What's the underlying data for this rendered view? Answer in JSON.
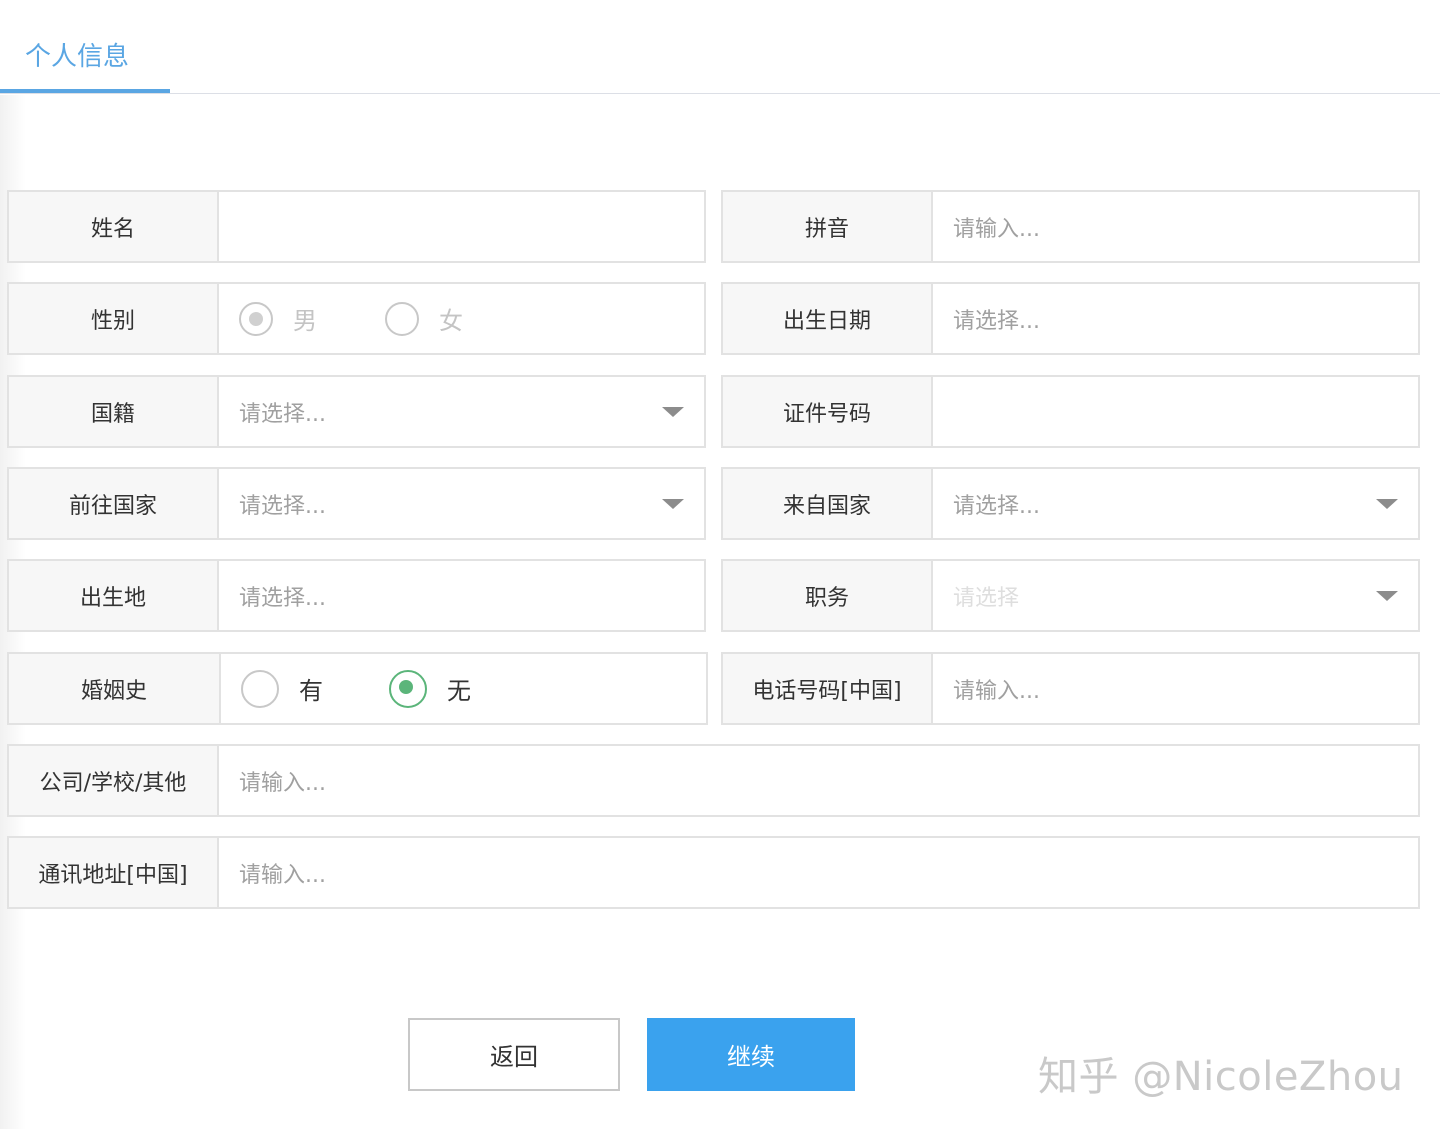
{
  "tabs": [
    {
      "label": "个人信息",
      "active": true
    }
  ],
  "form": {
    "name": {
      "label": "姓名",
      "value": ""
    },
    "pinyin": {
      "label": "拼音",
      "placeholder": "请输入..."
    },
    "gender": {
      "label": "性别",
      "options": [
        "男",
        "女"
      ],
      "selected": "男",
      "disabled": true
    },
    "birth_date": {
      "label": "出生日期",
      "placeholder": "请选择..."
    },
    "nationality": {
      "label": "国籍",
      "placeholder": "请选择..."
    },
    "id_number": {
      "label": "证件号码",
      "value": ""
    },
    "destination_country": {
      "label": "前往国家",
      "placeholder": "请选择..."
    },
    "from_country": {
      "label": "来自国家",
      "placeholder": "请选择..."
    },
    "birthplace": {
      "label": "出生地",
      "placeholder": "请选择..."
    },
    "position": {
      "label": "职务",
      "placeholder": "请选择",
      "disabled": true
    },
    "marital_history": {
      "label": "婚姻史",
      "options": [
        "有",
        "无"
      ],
      "selected": "无"
    },
    "phone": {
      "label": "电话号码[中国]",
      "placeholder": "请输入..."
    },
    "organization": {
      "label": "公司/学校/其他",
      "placeholder": "请输入..."
    },
    "address": {
      "label": "通讯地址[中国]",
      "placeholder": "请输入..."
    }
  },
  "buttons": {
    "back": "返回",
    "next": "继续"
  },
  "watermark": "知乎 @NicoleZhou",
  "colors": {
    "accent": "#5aa6e3",
    "primary_button": "#3aa2ee",
    "radio_checked": "#5bb57a"
  }
}
